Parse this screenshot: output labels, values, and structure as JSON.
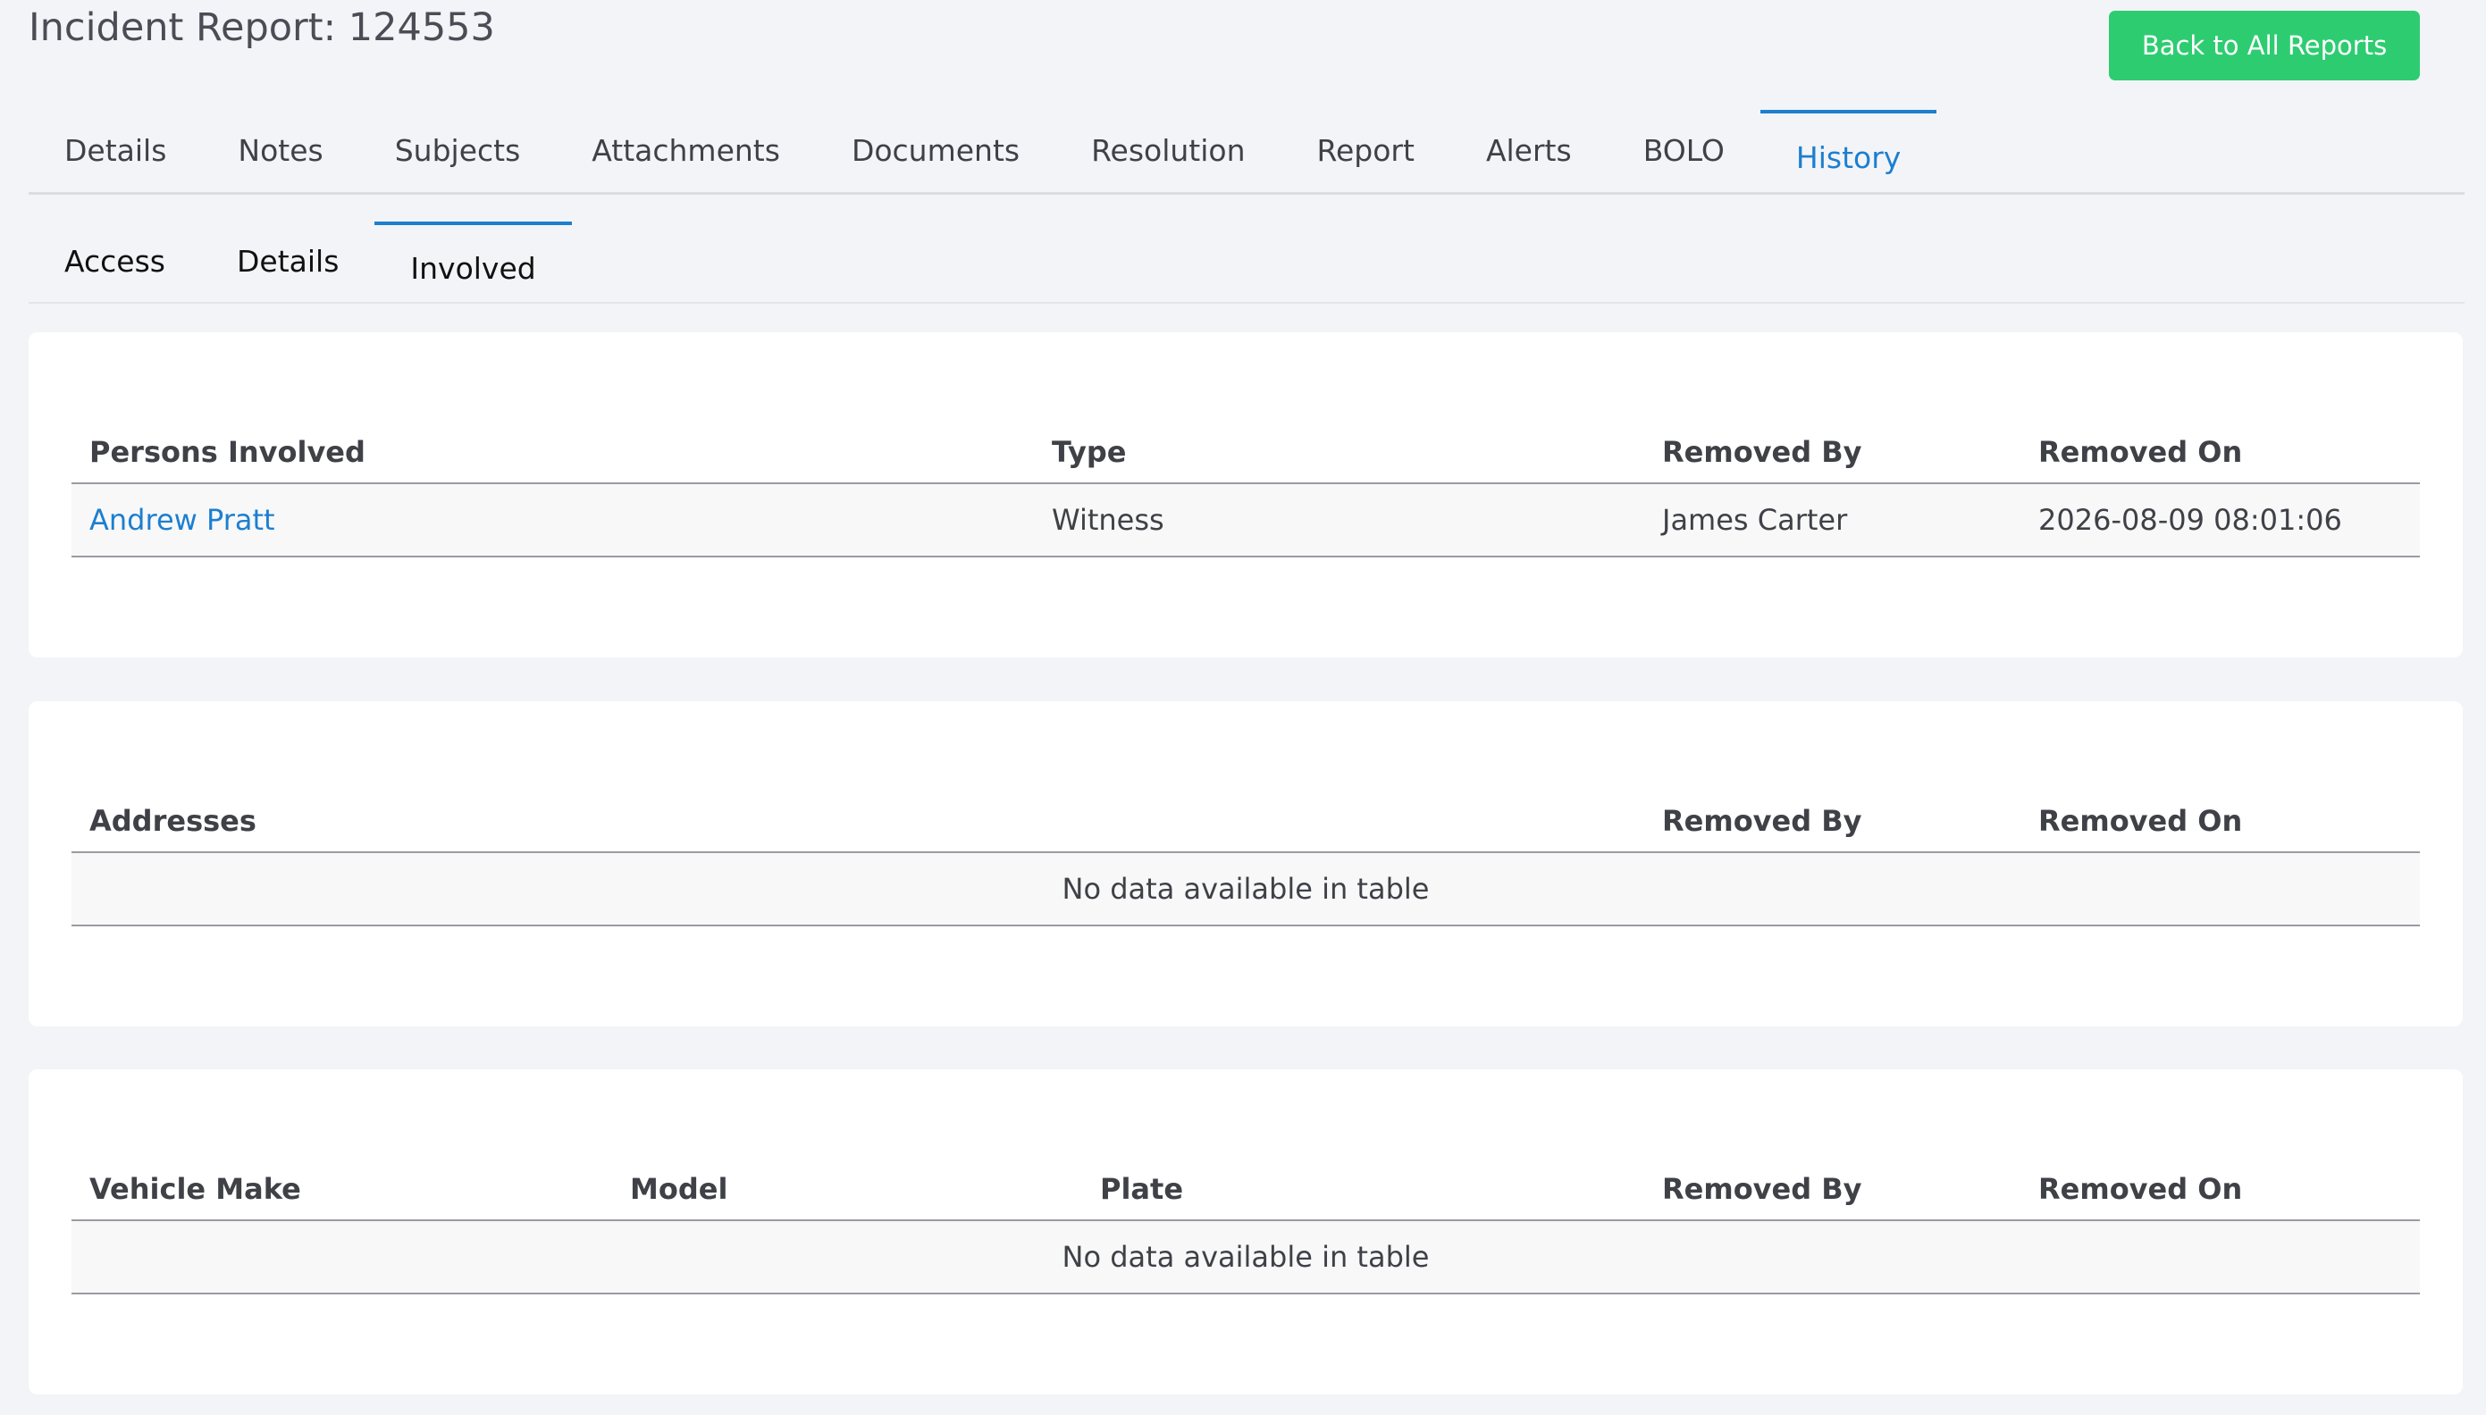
{
  "header": {
    "title": "Incident Report: 124553",
    "back_button": "Back to All Reports"
  },
  "colors": {
    "accent": "#1c7fd0",
    "primary_button": "#2ecc71",
    "background": "#f3f4f7"
  },
  "tabs": [
    "Details",
    "Notes",
    "Subjects",
    "Attachments",
    "Documents",
    "Resolution",
    "Report",
    "Alerts",
    "BOLO",
    "History"
  ],
  "active_tab": "History",
  "subtabs": [
    "Access",
    "Details",
    "Involved"
  ],
  "active_subtab": "Involved",
  "persons_table": {
    "headers": [
      "Persons Involved",
      "Type",
      "Removed By",
      "Removed On"
    ],
    "rows": [
      {
        "name": "Andrew Pratt",
        "type": "Witness",
        "removed_by": "James Carter",
        "removed_on": "2026-08-09 08:01:06"
      }
    ]
  },
  "addresses_table": {
    "headers": [
      "Addresses",
      "Removed By",
      "Removed On"
    ],
    "empty_text": "No data available in table"
  },
  "vehicles_table": {
    "headers": [
      "Vehicle Make",
      "Model",
      "Plate",
      "Removed By",
      "Removed On"
    ],
    "empty_text": "No data available in table"
  }
}
